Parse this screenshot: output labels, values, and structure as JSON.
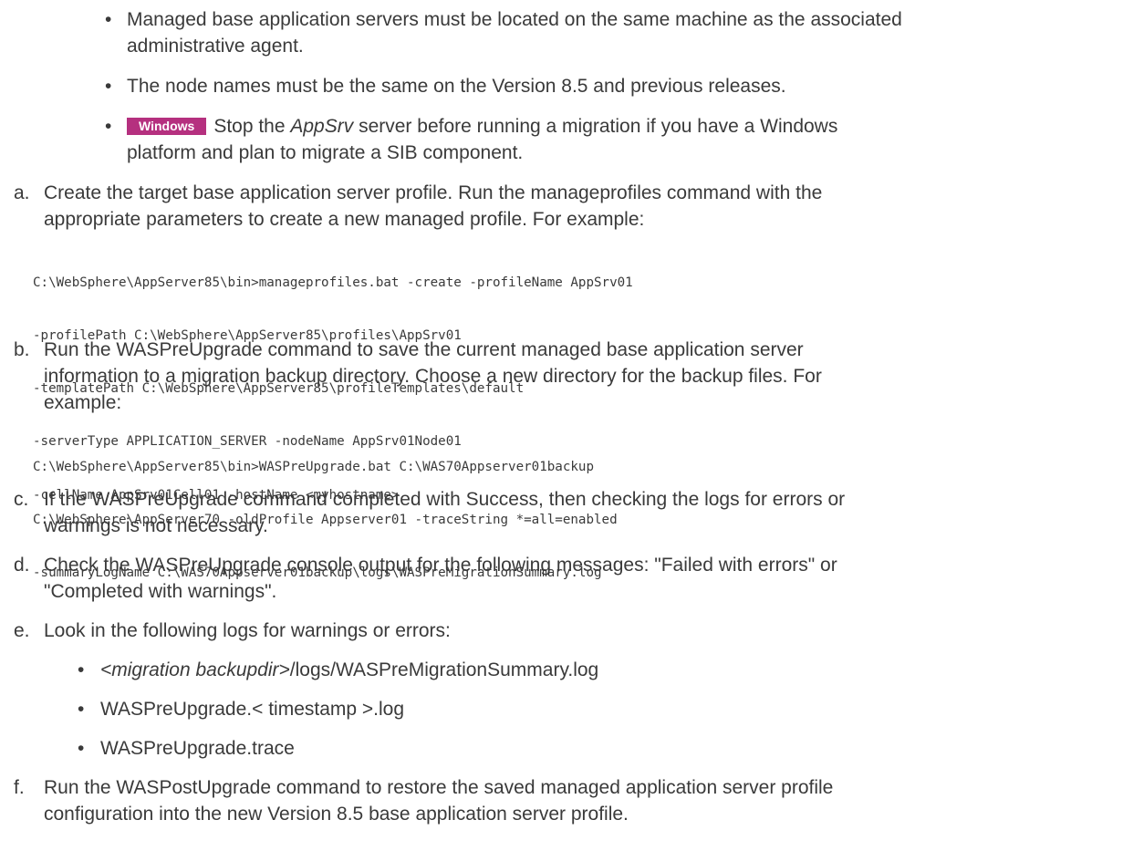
{
  "bullets_top": [
    {
      "line1": "Managed base application servers must be located on the same machine as the associated",
      "line2": "administrative agent."
    },
    {
      "line1": "The node names must be the same on the Version 8.5 and previous releases."
    },
    {
      "badge": "Windows",
      "pre": "Stop the ",
      "em": "AppSrv",
      "post": " server before running a migration if you have a Windows",
      "line2": "platform and plan to migrate a SIB component."
    }
  ],
  "steps": {
    "a": {
      "marker": "a.",
      "line1": "Create the target base application server profile. Run the manageprofiles command with the",
      "line2": "appropriate parameters to create a new managed profile. For example:",
      "code": [
        "C:\\WebSphere\\AppServer85\\bin>manageprofiles.bat -create -profileName AppSrv01",
        "-profilePath C:\\WebSphere\\AppServer85\\profiles\\AppSrv01",
        "-templatePath C:\\WebSphere\\AppServer85\\profileTemplates\\default",
        "-serverType APPLICATION_SERVER -nodeName AppSrv01Node01",
        "-cellName AppSrv01Cell01 -hostName <myhostname>"
      ]
    },
    "b": {
      "marker": "b.",
      "line1": "Run the WASPreUpgrade command to save the current managed base application server",
      "line2": "information to a migration backup directory. Choose a new directory for the backup files. For",
      "line3": "example:",
      "code": [
        "C:\\WebSphere\\AppServer85\\bin>WASPreUpgrade.bat C:\\WAS70Appserver01backup",
        "C:\\WebSphere\\AppServer70 -oldProfile Appserver01 -traceString *=all=enabled",
        "-summaryLogName C:\\WAS70Appserver01backup\\logs\\WASPreMigrationSummary.log"
      ]
    },
    "c": {
      "marker": "c.",
      "line1": "If the WASPreUpgrade command completed with Success, then checking the logs for errors or",
      "line2": "warnings is not necessary."
    },
    "d": {
      "marker": "d.",
      "line1": "Check the WASPreUpgrade console output for the following messages: \"Failed with errors\" or",
      "line2": "\"Completed with warnings\"."
    },
    "e": {
      "marker": "e.",
      "line1": "Look in the following logs for warnings or errors:",
      "logs": [
        {
          "em": "<migration backupdir>",
          "post": "/logs/WASPreMigrationSummary.log"
        },
        {
          "text": "WASPreUpgrade.< timestamp >.log"
        },
        {
          "text": "WASPreUpgrade.trace"
        }
      ]
    },
    "f": {
      "marker": "f.",
      "line1": "Run the WASPostUpgrade command to restore the saved managed application server profile",
      "line2": "configuration into the new Version 8.5 base application server profile."
    }
  },
  "bullet_char": "•"
}
